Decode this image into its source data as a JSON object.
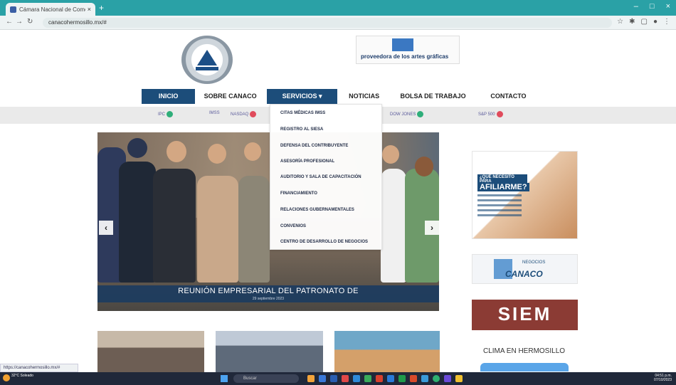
{
  "browser": {
    "tab_title": "Cámara Nacional de Comercio...",
    "tab_close": "×",
    "new_tab": "+",
    "url": "canacohermosillo.mx/#",
    "window_controls": [
      "–",
      "□",
      "×"
    ]
  },
  "header": {
    "gg_logo_text": "proveedora de los artes gráficas"
  },
  "nav": {
    "items": [
      "INICIO",
      "SOBRE CANACO",
      "SERVICIOS ▾",
      "NOTICIAS",
      "BOLSA DE TRABAJO",
      "CONTACTO"
    ]
  },
  "ticker": {
    "items": [
      "IPC",
      "IMSS",
      "NASDAQ",
      "DOW JONES",
      "S&P 500"
    ]
  },
  "dropdown": {
    "items": [
      "CITAS MÉDICAS IMSS",
      "REGISTRO AL SIESA",
      "DEFENSA DEL CONTRIBUYENTE",
      "ASESORÍA PROFESIONAL",
      "AUDITORIO Y SALA DE CAPACITACIÓN",
      "FINANCIAMIENTO",
      "RELACIONES GUBERNAMENTALES",
      "CONVENIOS",
      "CENTRO DE DESARROLLO DE NEGOCIOS"
    ]
  },
  "hero": {
    "caption": "REUNIÓN EMPRESARIAL DEL PATRONATO DE",
    "date": "29 septiembre 2023",
    "prev": "‹",
    "next": "›"
  },
  "sidebar": {
    "afiliarme_header": "¿QUÉ NECESITO PARA",
    "afiliarme_title": "AFILIARME?",
    "negocios_small": "NEGOCIOS",
    "negocios_title": "CANACO",
    "siem": "SIEM",
    "clima": "CLIMA EN HERMOSILLO"
  },
  "status_url": "https://canacohermosillo.mx/#",
  "taskbar": {
    "weather": "32°C Soleado",
    "search": "Buscar",
    "time": "04:51 p.m.",
    "date": "07/10/2023"
  },
  "colors": {
    "nav_active": "#1c4d7a",
    "browser_accent": "#2aa1a6",
    "siem": "#8b3b34"
  }
}
